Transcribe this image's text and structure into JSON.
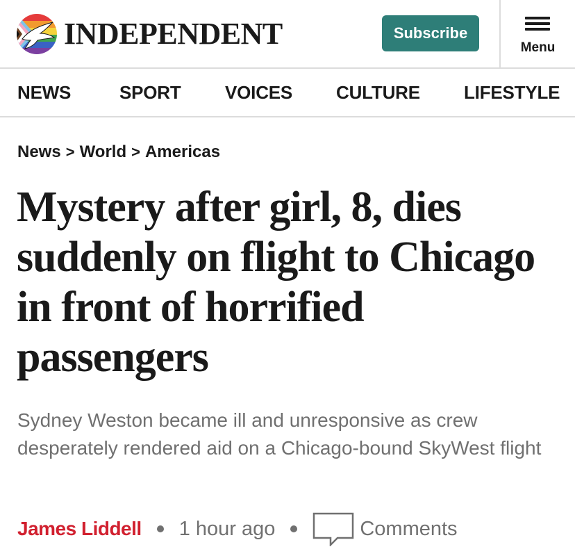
{
  "header": {
    "brand": "INDEPENDENT",
    "subscribe_label": "Subscribe",
    "menu_label": "Menu"
  },
  "nav": {
    "items": [
      {
        "label": "NEWS"
      },
      {
        "label": "SPORT"
      },
      {
        "label": "VOICES"
      },
      {
        "label": "CULTURE"
      },
      {
        "label": "LIFESTYLE"
      }
    ]
  },
  "breadcrumb": {
    "items": [
      "News",
      "World",
      "Americas"
    ],
    "separator": ">"
  },
  "article": {
    "headline": "Mystery after girl, 8, dies suddenly on flight to Chicago in front of horrified passengers",
    "standfirst": "Sydney Weston became ill and unresponsive as crew desperately rendered aid on a Chicago-bound SkyWest flight",
    "author": "James Liddell",
    "published": "1 hour ago",
    "comments_label": "Comments"
  },
  "icons": {
    "logo": "eagle-pride-logo-icon",
    "menu": "hamburger-menu-icon",
    "comments": "speech-bubble-icon"
  },
  "colors": {
    "subscribe_bg": "#2e7e78",
    "author": "#d1202f",
    "meta_text": "#707070",
    "text": "#1a1a1a",
    "divider": "#dcdcdc"
  }
}
